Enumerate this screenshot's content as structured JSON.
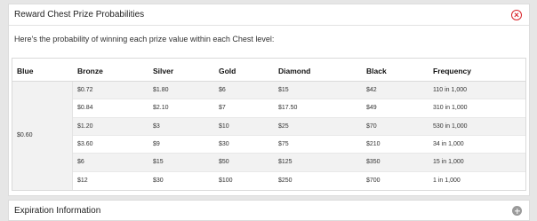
{
  "prize_panel": {
    "title": "Reward Chest Prize Probabilities",
    "intro": "Here's the probability of winning each prize value within each Chest level:"
  },
  "table": {
    "columns": [
      "Blue",
      "Bronze",
      "Silver",
      "Gold",
      "Diamond",
      "Black",
      "Frequency"
    ],
    "blue_value": "$0.60",
    "rows": [
      [
        "$0.72",
        "$1.80",
        "$6",
        "$15",
        "$42",
        "110 in 1,000"
      ],
      [
        "$0.84",
        "$2.10",
        "$7",
        "$17.50",
        "$49",
        "310 in 1,000"
      ],
      [
        "$1.20",
        "$3",
        "$10",
        "$25",
        "$70",
        "530 in 1,000"
      ],
      [
        "$3.60",
        "$9",
        "$30",
        "$75",
        "$210",
        "34 in 1,000"
      ],
      [
        "$6",
        "$15",
        "$50",
        "$125",
        "$350",
        "15 in 1,000"
      ],
      [
        "$12",
        "$30",
        "$100",
        "$250",
        "$700",
        "1 in 1,000"
      ]
    ]
  },
  "expiration_panel": {
    "title": "Expiration Information"
  },
  "colors": {
    "close_icon": "#d8232a",
    "expand_icon": "#9a9a9a",
    "stripe": "#f2f2f2"
  }
}
